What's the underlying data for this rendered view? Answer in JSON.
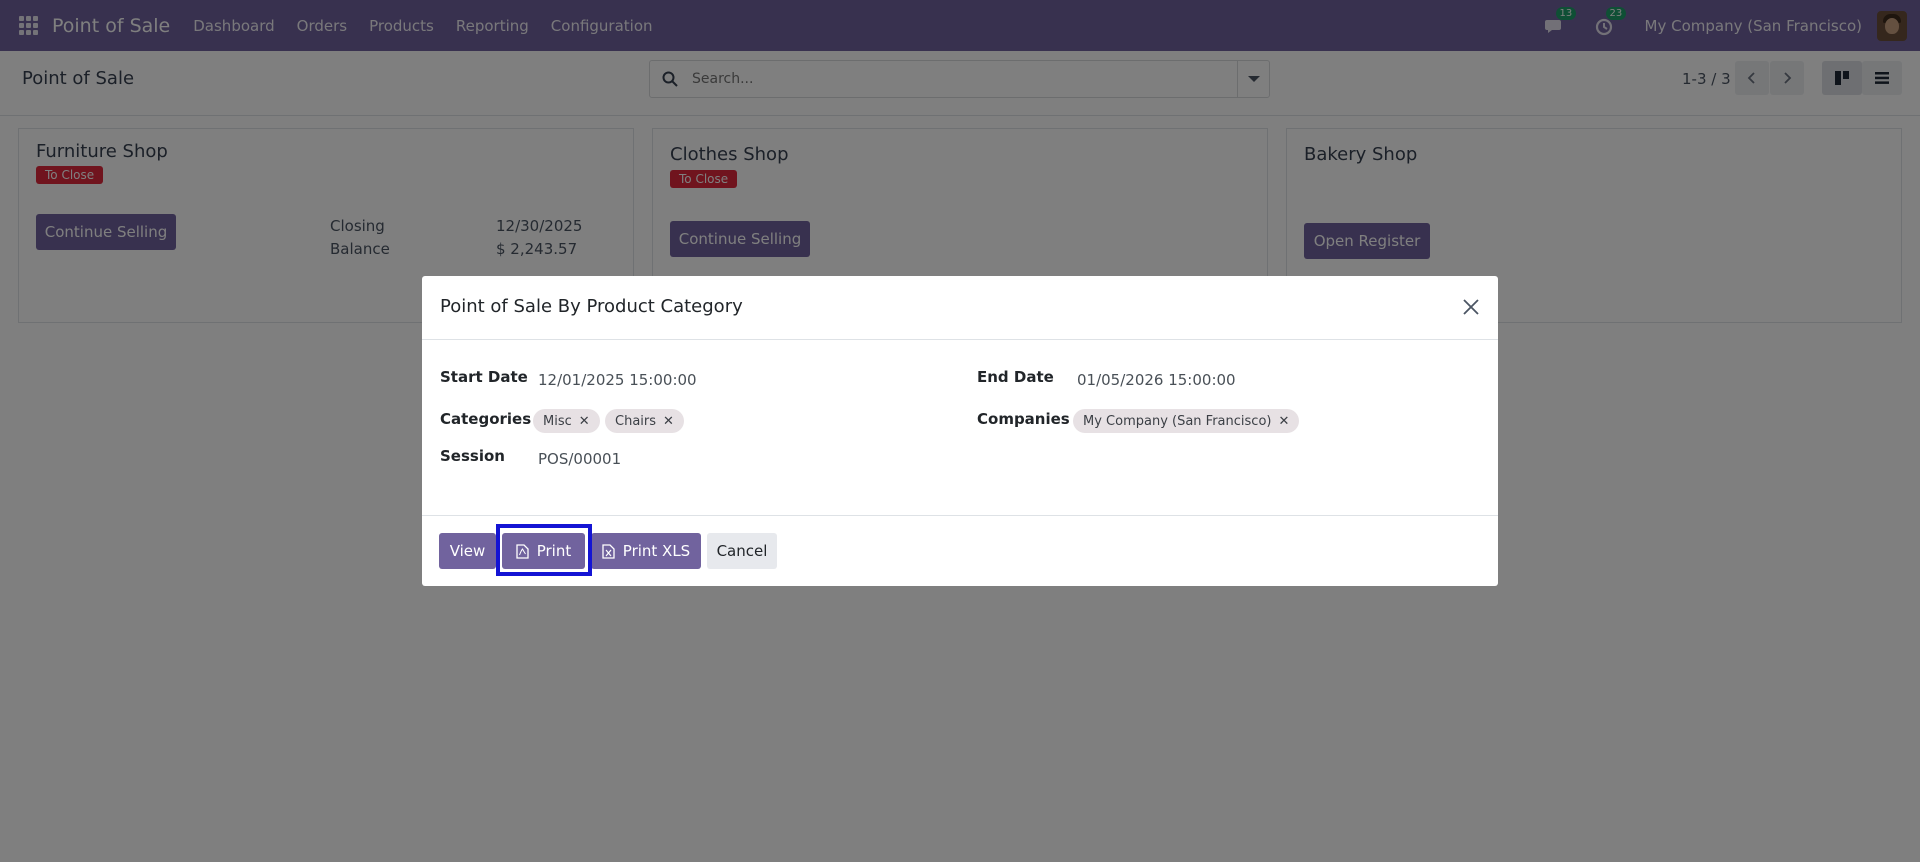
{
  "navbar": {
    "brand": "Point of Sale",
    "menu": [
      {
        "label": "Dashboard"
      },
      {
        "label": "Orders"
      },
      {
        "label": "Products"
      },
      {
        "label": "Reporting"
      },
      {
        "label": "Configuration"
      }
    ],
    "messages_count": "13",
    "activities_count": "23",
    "company": "My Company (San Francisco)",
    "color": "#71639e"
  },
  "control": {
    "title": "Point of Sale",
    "search_placeholder": "Search...",
    "pager": "1-3 / 3"
  },
  "kanban": {
    "cards": [
      {
        "name": "Furniture Shop",
        "status": "To Close",
        "button": "Continue Selling",
        "closing_label": "Closing",
        "closing_value": "12/30/2025",
        "balance_label": "Balance",
        "balance_value": "$ 2,243.57"
      },
      {
        "name": "Clothes Shop",
        "status": "To Close",
        "button": "Continue Selling"
      },
      {
        "name": "Bakery Shop",
        "button": "Open Register"
      }
    ]
  },
  "dialog": {
    "title": "Point of Sale By Product Category",
    "start_date_label": "Start Date",
    "start_date_value": "12/01/2025 15:00:00",
    "end_date_label": "End Date",
    "end_date_value": "01/05/2026 15:00:00",
    "categories_label": "Categories",
    "categories": [
      "Misc",
      "Chairs"
    ],
    "companies_label": "Companies",
    "companies": [
      "My Company (San Francisco)"
    ],
    "session_label": "Session",
    "session_value": "POS/00001",
    "buttons": {
      "view": "View",
      "print": "Print",
      "print_xls": "Print XLS",
      "cancel": "Cancel"
    }
  }
}
